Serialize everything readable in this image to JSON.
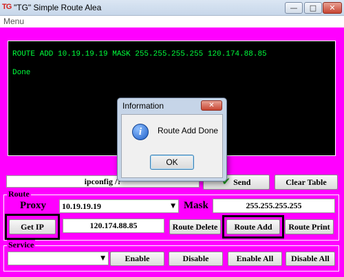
{
  "window": {
    "logo_text": "TG",
    "title": "\"TG\"  Simple Route  Alea",
    "controls": {
      "minimize": "—",
      "maximize": "□",
      "close": "✕"
    }
  },
  "menu": {
    "label": "Menu"
  },
  "console": {
    "lines": [
      "ROUTE ADD 10.19.19.19 MASK 255.255.255.255 120.174.88.85",
      "Done"
    ]
  },
  "command": {
    "value": "ipconfig /?",
    "send_label": "Send",
    "send_icon": "check-icon",
    "clear_label": "Clear Table"
  },
  "route": {
    "group_label": "Route",
    "proxy_label": "Proxy",
    "proxy_value": "10.19.19.19",
    "mask_label": "Mask",
    "mask_value": "255.255.255.255",
    "get_ip_label": "Get IP",
    "ip_value": "120.174.88.85",
    "delete_label": "Route Delete",
    "add_label": "Route Add",
    "print_label": "Route Print"
  },
  "service": {
    "group_label": "Service",
    "selected": "",
    "enable_label": "Enable",
    "disable_label": "Disable",
    "enable_all_label": "Enable All",
    "disable_all_label": "Disable All"
  },
  "dialog": {
    "title": "Information",
    "icon": "info-icon",
    "icon_glyph": "i",
    "message": "Route Add Done",
    "ok_label": "OK",
    "close_glyph": "✕"
  },
  "colors": {
    "background": "#ff00ff",
    "console_bg": "#000000",
    "console_text": "#00ff3c",
    "highlight_frame": "#000000"
  }
}
